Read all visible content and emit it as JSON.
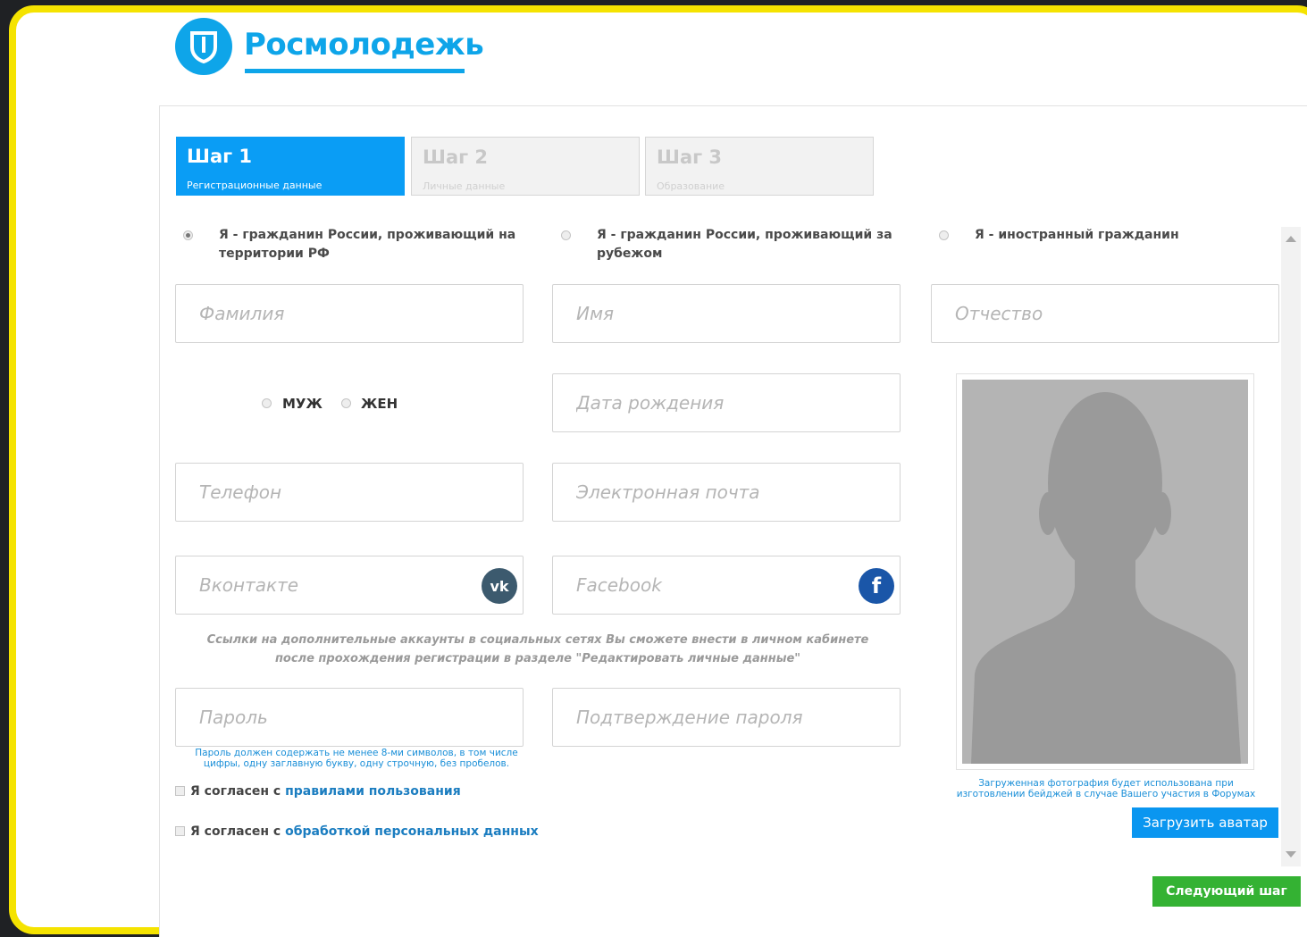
{
  "brand": {
    "name": "Росмолодежь"
  },
  "steps": [
    {
      "title": "Шаг 1",
      "subtitle": "Регистрационные данные"
    },
    {
      "title": "Шаг 2",
      "subtitle": "Личные данные"
    },
    {
      "title": "Шаг 3",
      "subtitle": "Образование"
    }
  ],
  "citizenship": [
    {
      "label": "Я - гражданин России, проживающий на территории РФ",
      "checked": true
    },
    {
      "label": "Я - гражданин России, проживающий за рубежом",
      "checked": false
    },
    {
      "label": "Я - иностранный гражданин",
      "checked": false
    }
  ],
  "fields": {
    "last_name": "Фамилия",
    "first_name": "Имя",
    "middle_name": "Отчество",
    "birth_date": "Дата рождения",
    "phone": "Телефон",
    "email": "Электронная почта",
    "vk": "Вконтакте",
    "facebook": "Facebook",
    "password": "Пароль",
    "password_confirm": "Подтверждение пароля"
  },
  "gender": {
    "male": "МУЖ",
    "female": "ЖЕН"
  },
  "social_icons": {
    "vk": "vk",
    "facebook": "f"
  },
  "notes": {
    "social_line1": "Ссылки на дополнительные аккаунты в социальных сетях Вы сможете внести в личном кабинете",
    "social_line2": "после прохождения регистрации в разделе \"Редактировать личные данные\"",
    "password_line1": "Пароль должен содержать не менее 8-ми символов, в том числе",
    "password_line2": "цифры, одну заглавную букву, одну строчную, без пробелов.",
    "photo_line1": "Загруженная фотография будет использована при",
    "photo_line2": "изготовлении бейджей в случае Вашего участия в Форумах"
  },
  "agreements": {
    "rules_prefix": "Я согласен с ",
    "rules_link": "правилами пользования",
    "pd_prefix": "Я согласен с ",
    "pd_link": "обработкой персональных данных"
  },
  "buttons": {
    "upload": "Загрузить аватар",
    "next": "Следующий шаг"
  },
  "colors": {
    "brand": "#0ea5e9",
    "step_active": "#0a9df5",
    "next": "#34b233",
    "frame": "#f5e300"
  }
}
